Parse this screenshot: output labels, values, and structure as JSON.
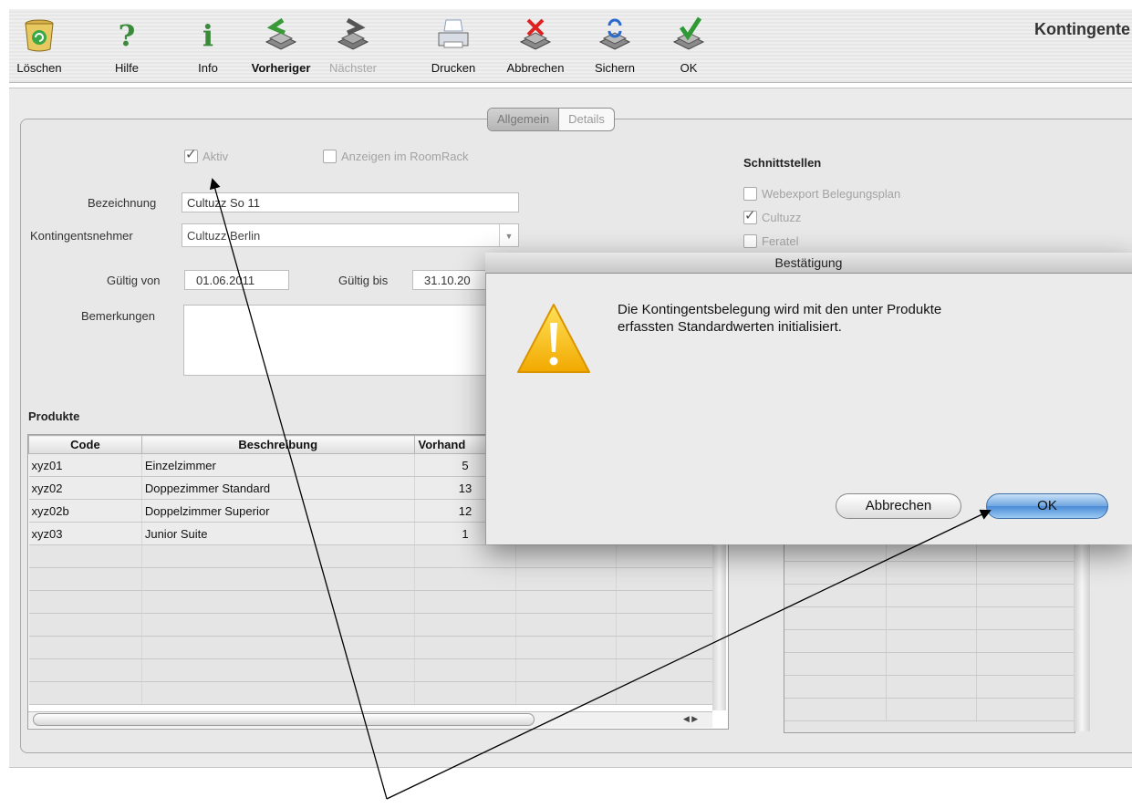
{
  "toolbar": {
    "buttons": [
      {
        "label": "Löschen",
        "icon": "trash-icon"
      },
      {
        "label": "Hilfe",
        "icon": "help-icon"
      },
      {
        "label": "Info",
        "icon": "info-icon"
      },
      {
        "label": "Vorheriger",
        "icon": "previous-record-icon"
      },
      {
        "label": "Nächster",
        "icon": "next-record-icon"
      },
      {
        "label": "Drucken",
        "icon": "printer-icon"
      },
      {
        "label": "Abbrechen",
        "icon": "cancel-icon"
      },
      {
        "label": "Sichern",
        "icon": "save-icon"
      },
      {
        "label": "OK",
        "icon": "ok-icon"
      }
    ],
    "window_title": "Kontingente"
  },
  "tabs": [
    "Allgemein",
    "Details"
  ],
  "form": {
    "aktiv_label": "Aktiv",
    "roomrack_label": "Anzeigen im RoomRack",
    "bezeichnung_label": "Bezeichnung",
    "bezeichnung_value": "Cultuzz So 11",
    "nehmer_label": "Kontingentsnehmer",
    "nehmer_value": "Cultuzz Berlin",
    "gueltig_von_label": "Gültig von",
    "gueltig_von_value": "01.06.2011",
    "gueltig_bis_label": "Gültig bis",
    "gueltig_bis_value": "31.10.20",
    "bemerkungen_label": "Bemerkungen"
  },
  "schnittstellen": {
    "title": "Schnittstellen",
    "items": [
      {
        "label": "Webexport Belegungsplan",
        "checked": false
      },
      {
        "label": "Cultuzz",
        "checked": true
      },
      {
        "label": "Feratel",
        "checked": false
      }
    ]
  },
  "produkte": {
    "title": "Produkte",
    "headers": [
      "Code",
      "Beschreibung",
      "Vorhand"
    ],
    "rows": [
      [
        "xyz01",
        "Einzelzimmer",
        "5"
      ],
      [
        "xyz02",
        "Doppezimmer Standard",
        "13"
      ],
      [
        "xyz02b",
        "Doppelzimmer Superior",
        "12"
      ],
      [
        "xyz03",
        "Junior Suite",
        "1"
      ]
    ]
  },
  "dialog": {
    "title": "Bestätigung",
    "message_line1": "Die Kontingentsbelegung wird mit den unter Produkte",
    "message_line2": "erfassten Standardwerten initialisiert.",
    "cancel_label": "Abbrechen",
    "ok_label": "OK"
  }
}
